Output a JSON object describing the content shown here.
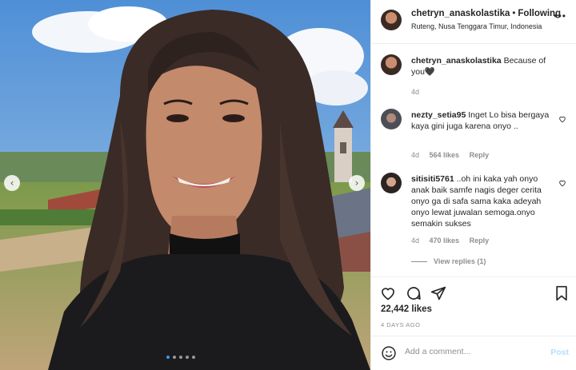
{
  "post": {
    "username": "chetryn_anaskolastika",
    "separator": "•",
    "follow_status": "Following",
    "location": "Ruteng, Nusa Tenggara Timur, Indonesia",
    "more_icon": "more-horizontal-icon",
    "carousel": {
      "dot_count": 5,
      "active_dot": 1
    }
  },
  "comments": [
    {
      "username": "chetryn_anaskolastika",
      "text": "Because of you🖤",
      "age": "4d",
      "likes": "",
      "reply": ""
    },
    {
      "username": "nezty_setia95",
      "text": "Inget Lo bisa bergaya kaya gini juga karena onyo ..",
      "age": "4d",
      "likes": "564 likes",
      "reply": "Reply"
    },
    {
      "username": "sitisiti5761",
      "text": "oh ini kaka yah onyo anak baik samfe nagis deger cerita onyo ga di safa sama kaka adeyah onyo lewat juwalan semoga.onyo semakin sukses",
      "prefix": "..",
      "age": "4d",
      "likes": "470 likes",
      "reply": "Reply"
    }
  ],
  "view_replies": "View replies (1)",
  "actions": {
    "likes": "22,442 likes",
    "time_ago": "4 DAYS AGO",
    "icons": [
      "heart-icon",
      "comment-icon",
      "share-icon",
      "bookmark-icon"
    ]
  },
  "add_comment": {
    "placeholder": "Add a comment...",
    "post_label": "Post",
    "emoji_icon": "emoji-icon"
  },
  "colors": {
    "accent": "#3897f0",
    "post_disabled": "#b2dffc",
    "muted": "#8e8e8e",
    "text": "#262626"
  }
}
